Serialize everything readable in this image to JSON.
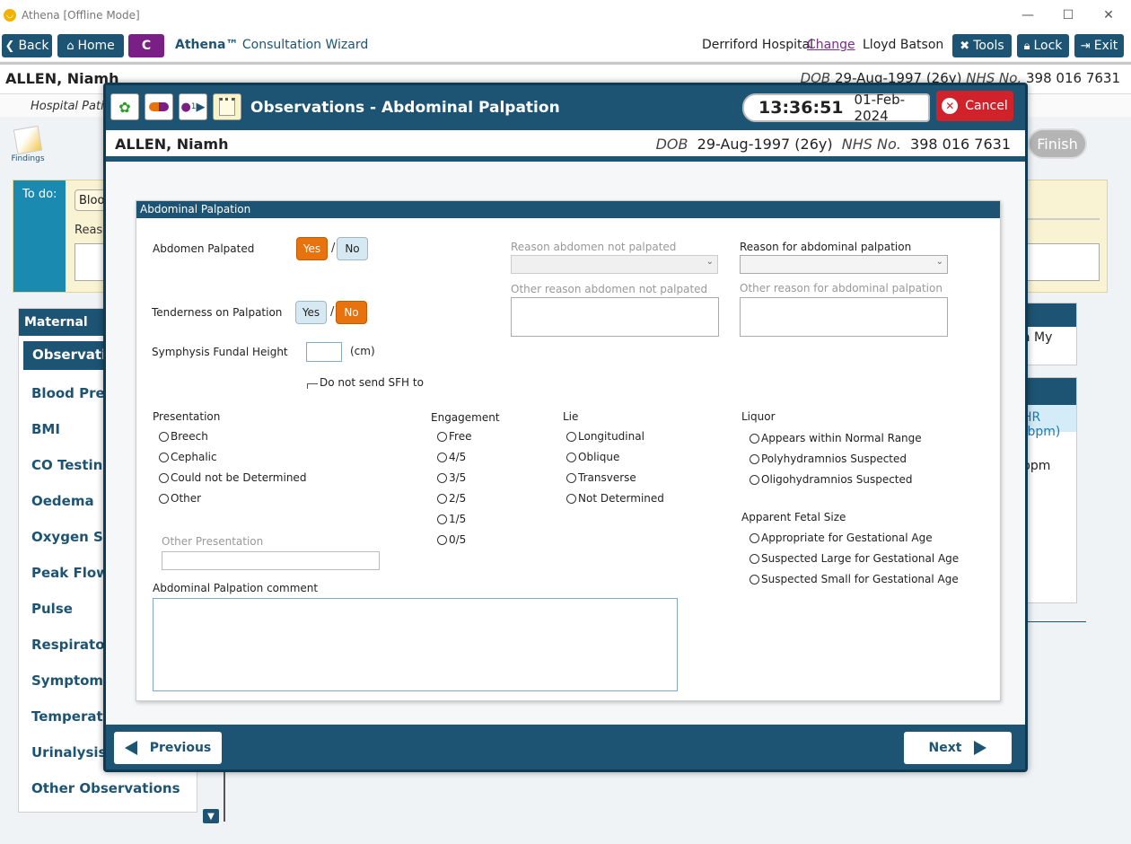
{
  "window": {
    "title": "Athena [Offline Mode]",
    "minimize": "—",
    "maximize": "☐",
    "close": "✕"
  },
  "navbar": {
    "back": "Back",
    "home": "Home",
    "c_label": "C",
    "brand": "Athena™",
    "subtitle": "Consultation Wizard",
    "hospital": "Derriford Hospital",
    "change": "Change",
    "user": "Lloyd Batson",
    "tools": "Tools",
    "lock": "Lock",
    "exit": "Exit"
  },
  "patient": {
    "name": "ALLEN, Niamh",
    "dob_label": "DOB",
    "dob": "29-Aug-1997 (26y)",
    "nhs_label": "NHS No.",
    "nhs": "398 016 7631",
    "sub_banner": "Hospital Patie"
  },
  "background": {
    "findings": "Findings",
    "finish": "Finish",
    "todo_label": "To do:",
    "todo_chip": "Bloo",
    "todo_reason": "Reaso",
    "maternal_header": "Maternal",
    "maternal_items": [
      "Observation",
      "Blood Press",
      "BMI",
      "CO Testing",
      "Oedema",
      "Oxygen Sat",
      "Peak Flow",
      "Pulse",
      "Respiratory",
      "Symptoms",
      "Temperatur",
      "Urinalysis",
      "Other Observations"
    ],
    "right_text1": "a My",
    "right_header2": "HR (bpm)",
    "right_text2": "bpm"
  },
  "modal": {
    "title": "Observations - Abdominal Palpation",
    "time": "13:36:51",
    "date": "01-Feb-2024",
    "cancel": "Cancel",
    "previous": "Previous",
    "next": "Next",
    "toolbar_icons": [
      "flower-icon",
      "pill-icon",
      "people-icon",
      "notepad-icon"
    ],
    "toolbar_badge": "1"
  },
  "form": {
    "section_title": "Abdominal Palpation",
    "abdomen_palpated": {
      "label": "Abdomen Palpated",
      "yes": "Yes",
      "no": "No",
      "selected": "Yes"
    },
    "tenderness": {
      "label": "Tenderness on Palpation",
      "yes": "Yes",
      "no": "No",
      "selected": "No"
    },
    "sfh": {
      "label": "Symphysis Fundal Height",
      "unit": "(cm)",
      "value": ""
    },
    "do_not_send": "Do not send SFH to",
    "reason_not_palpated": "Reason abdomen not palpated",
    "other_reason_not_palpated": "Other reason abdomen not palpated",
    "reason_for_palpation": "Reason for abdominal palpation",
    "other_reason_for_palpation": "Other reason for abdominal palpation",
    "presentation": {
      "label": "Presentation",
      "options": [
        "Breech",
        "Cephalic",
        "Could not be Determined",
        "Other"
      ]
    },
    "other_presentation": "Other Presentation",
    "engagement": {
      "label": "Engagement",
      "options": [
        "Free",
        "4/5",
        "3/5",
        "2/5",
        "1/5",
        "0/5"
      ]
    },
    "lie": {
      "label": "Lie",
      "options": [
        "Longitudinal",
        "Oblique",
        "Transverse",
        "Not Determined"
      ]
    },
    "liquor": {
      "label": "Liquor",
      "options": [
        "Appears within Normal Range",
        "Polyhydramnios Suspected",
        "Oligohydramnios Suspected"
      ]
    },
    "fetal_size": {
      "label": "Apparent Fetal Size",
      "options": [
        "Appropriate for Gestational Age",
        "Suspected Large for Gestational Age",
        "Suspected Small for Gestational Age"
      ]
    },
    "comment": "Abdominal Palpation comment"
  },
  "colors": {
    "primary": "#1d5473",
    "accent_orange": "#e8730e",
    "cancel_red": "#d0222a",
    "purple": "#7a1f86"
  }
}
